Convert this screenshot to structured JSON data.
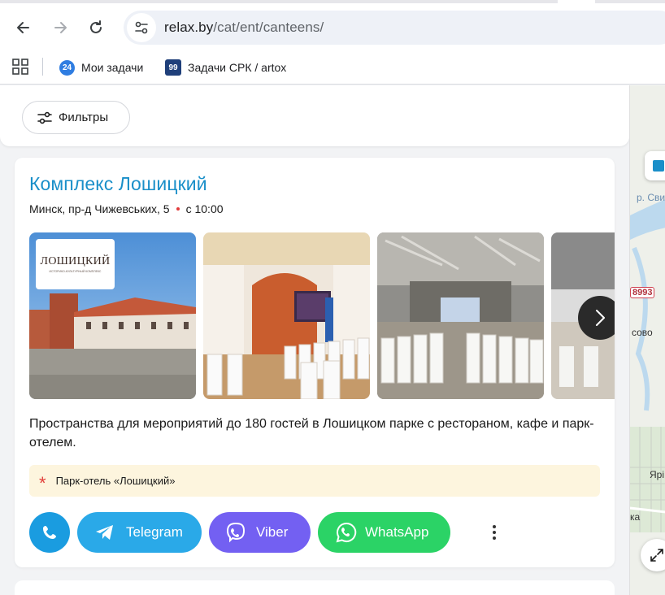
{
  "browser": {
    "url_host": "relax.by",
    "url_path": "/cat/ent/canteens/",
    "bookmarks": [
      {
        "label": "Мои задачи",
        "badge": "24"
      },
      {
        "label": "Задачи СРК / artox",
        "badge": "99"
      }
    ]
  },
  "filters": {
    "label": "Фильтры"
  },
  "listing": {
    "title": "Комплекс Лошицкий",
    "address": "Минск, пр-д Чижевських, 5",
    "hours": "с 10:00",
    "logo_text": "ЛОШИЦКИЙ",
    "logo_subtext": "ИСТОРИКО-КУЛЬТУРНЫЙ КОМПЛЕКС",
    "description": "Пространства для мероприятий до 180 гостей в Лошицком парке с рестораном, кафе и парк-отелем.",
    "note": "Парк-отель «Лошицкий»",
    "contacts": {
      "telegram": "Telegram",
      "viber": "Viber",
      "whatsapp": "WhatsApp"
    }
  },
  "map": {
    "labels": [
      "р. Сви",
      "сово",
      "Ярі",
      "ка"
    ],
    "road_badge": "8993"
  },
  "colors": {
    "title_blue": "#1a8fc9",
    "phone_blue": "#1a9ce0",
    "telegram": "#2aa9e8",
    "viber": "#7360f2",
    "whatsapp": "#2bd366",
    "note_bg": "#fdf5de"
  }
}
